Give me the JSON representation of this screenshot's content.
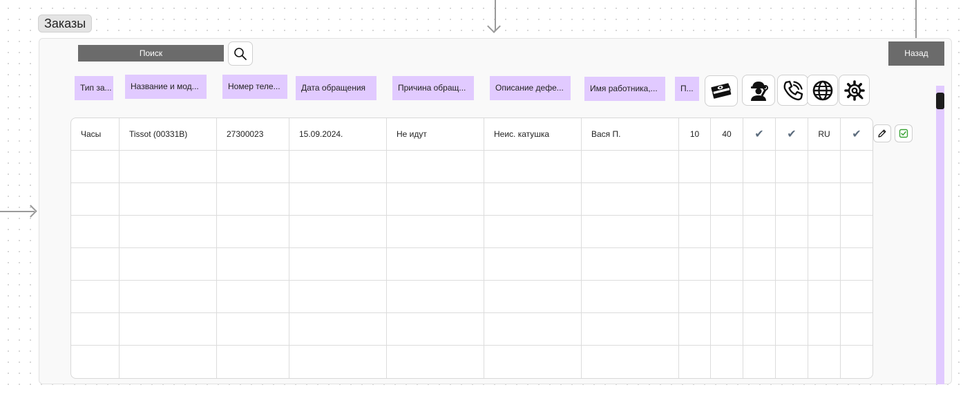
{
  "frame": {
    "title": "Заказы"
  },
  "toolbar": {
    "search_label": "Поиск",
    "back_label": "Назад"
  },
  "columns": [
    "Тип за...",
    "Название и мод...",
    "Номер теле...",
    "Дата обращения",
    "Причина обращ...",
    "Описание дефе...",
    "Имя работника,...",
    "П..."
  ],
  "icon_columns": [
    "money-icon",
    "repairman-icon",
    "phone-icon",
    "globe-icon",
    "gear-wrench-icon"
  ],
  "rows": [
    {
      "type": "Часы",
      "model": "Tissot (00331B)",
      "phone": "27300023",
      "date": "15.09.2024.",
      "reason": "Не идут",
      "defect": "Неис. катушка",
      "worker": "Вася П.",
      "p": "10",
      "price": "40",
      "master": "✔",
      "call": "✔",
      "lang": "RU",
      "settings": "✔"
    }
  ],
  "row_actions": [
    "edit-icon",
    "checkbox-icon"
  ],
  "colors": {
    "accent": "#e1caff",
    "button": "#6b6b6b"
  }
}
